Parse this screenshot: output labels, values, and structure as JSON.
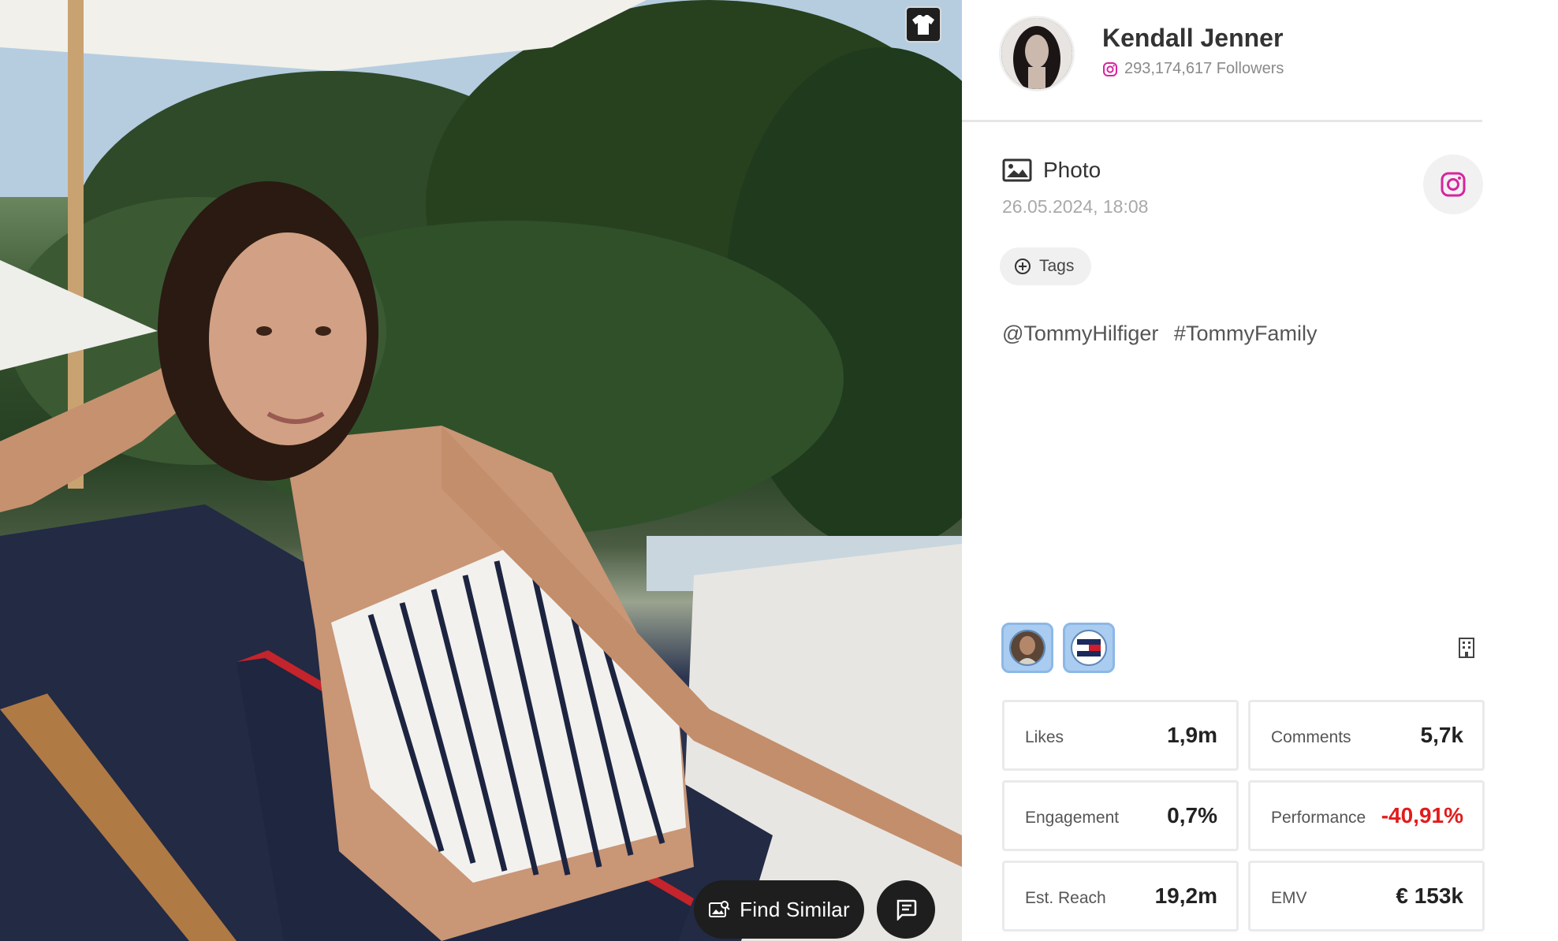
{
  "photo": {
    "find_similar_label": "Find Similar"
  },
  "profile": {
    "name": "Kendall Jenner",
    "followers": "293,174,617 Followers"
  },
  "post": {
    "type": "Photo",
    "date": "26.05.2024, 18:08",
    "tags_label": "Tags",
    "caption": "@TommyHilfiger #TommyFamily"
  },
  "stats": {
    "likes_label": "Likes",
    "likes": "1,9m",
    "comments_label": "Comments",
    "comments": "5,7k",
    "engagement_label": "Engagement",
    "engagement": "0,7%",
    "performance_label": "Performance",
    "performance": "-40,91%",
    "reach_label": "Est. Reach",
    "reach": "19,2m",
    "emv_label": "EMV",
    "emv": "€ 153k"
  },
  "colors": {
    "instagram": "#d6249f",
    "negative": "#e31b1b",
    "chip": "#a9ccf0"
  },
  "icons": [
    "tshirt-icon",
    "find-similar-icon",
    "comment-icon",
    "instagram-icon",
    "image-icon",
    "add-circle-icon",
    "building-icon"
  ]
}
